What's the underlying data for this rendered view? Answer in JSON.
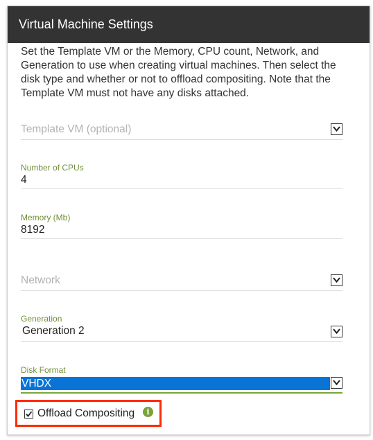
{
  "panel": {
    "title": "Virtual Machine Settings",
    "description": "Set the Template VM or the Memory, CPU count, Network, and Generation to use when creating virtual machines. Then select the disk type and whether or not to offload compositing. Note that the Template VM must not have any disks attached."
  },
  "fields": {
    "template_vm": {
      "placeholder": "Template VM (optional)",
      "icon": "chevron-down-icon"
    },
    "cpus": {
      "label": "Number of CPUs",
      "value": "4"
    },
    "memory": {
      "label": "Memory (Mb)",
      "value": "8192"
    },
    "network": {
      "placeholder": "Network",
      "icon": "chevron-down-icon"
    },
    "generation": {
      "label": "Generation",
      "value": "Generation 2",
      "icon": "chevron-down-icon"
    },
    "disk_format": {
      "label": "Disk Format",
      "value": "VHDX",
      "icon": "chevron-down-icon"
    }
  },
  "offload": {
    "label": "Offload Compositing",
    "checked": true,
    "info_icon": "i"
  },
  "colors": {
    "header_bg": "#333333",
    "label_green": "#6f8f3a",
    "selection_blue": "#0a74d6",
    "highlight_red": "#ff2a00"
  }
}
